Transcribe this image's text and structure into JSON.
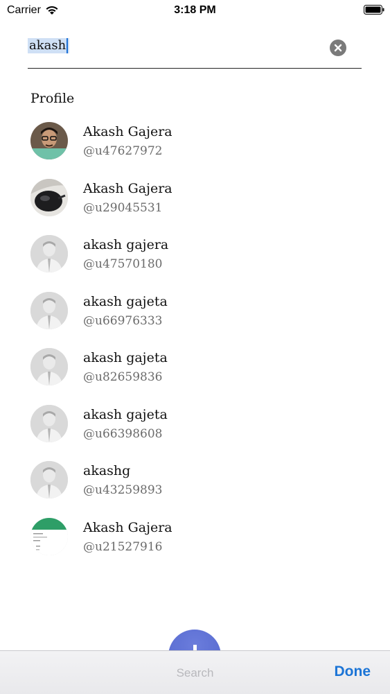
{
  "status_bar": {
    "carrier": "Carrier",
    "time": "3:18 PM"
  },
  "search": {
    "value": "akash",
    "clear_icon": "close-circle-icon"
  },
  "section": {
    "title": "Profile"
  },
  "profiles": [
    {
      "name": "Akash Gajera",
      "handle": "@u47627972",
      "avatar": "photo-person"
    },
    {
      "name": "Akash Gajera",
      "handle": "@u29045531",
      "avatar": "photo-object"
    },
    {
      "name": "akash gajera",
      "handle": "@u47570180",
      "avatar": "placeholder-person"
    },
    {
      "name": "akash gajeta",
      "handle": "@u66976333",
      "avatar": "placeholder-person"
    },
    {
      "name": "akash gajeta",
      "handle": "@u82659836",
      "avatar": "placeholder-person"
    },
    {
      "name": "akash gajeta",
      "handle": "@u66398608",
      "avatar": "placeholder-person"
    },
    {
      "name": "akashg",
      "handle": "@u43259893",
      "avatar": "placeholder-person"
    },
    {
      "name": "Akash Gajera",
      "handle": "@u21527916",
      "avatar": "screenshot-thumbnail"
    }
  ],
  "bottom_bar": {
    "search_label": "Search",
    "done_label": "Done",
    "accent_color": "#1b74d6"
  }
}
